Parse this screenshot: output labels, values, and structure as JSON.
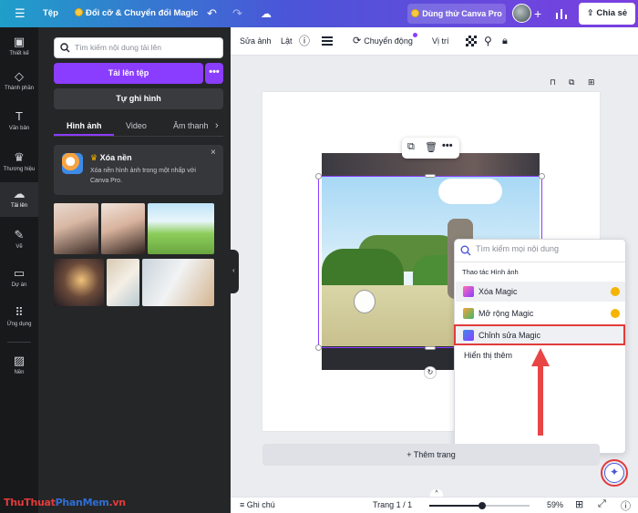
{
  "topbar": {
    "menu_icon": "menu-icon",
    "file": "Tệp",
    "resize": "Đổi cỡ & Chuyển đổi Magic",
    "try_pro": "Dùng thử Canva Pro",
    "share": "Chia sẻ"
  },
  "rail": [
    {
      "label": "Thiết kế",
      "icon": "layout-icon"
    },
    {
      "label": "Thành phần",
      "icon": "shapes-icon"
    },
    {
      "label": "Văn bản",
      "icon": "text-icon"
    },
    {
      "label": "Thương hiệu",
      "icon": "brand-icon"
    },
    {
      "label": "Tải lên",
      "icon": "upload-cloud-icon"
    },
    {
      "label": "Vẽ",
      "icon": "draw-icon"
    },
    {
      "label": "Dự án",
      "icon": "folder-icon"
    },
    {
      "label": "Ứng dụng",
      "icon": "apps-icon"
    },
    {
      "label": "Nền",
      "icon": "background-icon"
    }
  ],
  "panel": {
    "search_placeholder": "Tìm kiếm nội dung tải lên",
    "upload_label": "Tải lên tệp",
    "more_label": "•••",
    "record_label": "Tự ghi hình",
    "tabs": [
      "Hình ảnh",
      "Video",
      "Âm thanh"
    ],
    "promo_title": "Xóa nền",
    "promo_desc": "Xóa nền hình ảnh trong một nhấp với Canva Pro.",
    "promo_close": "×"
  },
  "toolbar": {
    "edit": "Sửa ảnh",
    "flip": "Lật",
    "animate": "Chuyển động",
    "position": "Vị trí"
  },
  "magic_menu": {
    "search_placeholder": "Tìm kiếm mọi nội dung",
    "section": "Thao tác Hình ảnh",
    "items": [
      {
        "label": "Xóa Magic",
        "pro": true
      },
      {
        "label": "Mở rộng Magic",
        "pro": true
      },
      {
        "label": "Chỉnh sửa Magic",
        "pro": false
      }
    ],
    "show_more": "Hiển thị thêm"
  },
  "canvas": {
    "add_page": "+ Thêm trang"
  },
  "bottom": {
    "notes": "Ghi chú",
    "page_indicator": "Trang 1 / 1",
    "zoom": "59%",
    "zoom_level": 0.59
  },
  "watermark": "ThuThuatPhanMem.vn",
  "colors": {
    "accent": "#8b3dff",
    "highlight": "#e23b3b",
    "pro_crown": "#f5b400"
  }
}
